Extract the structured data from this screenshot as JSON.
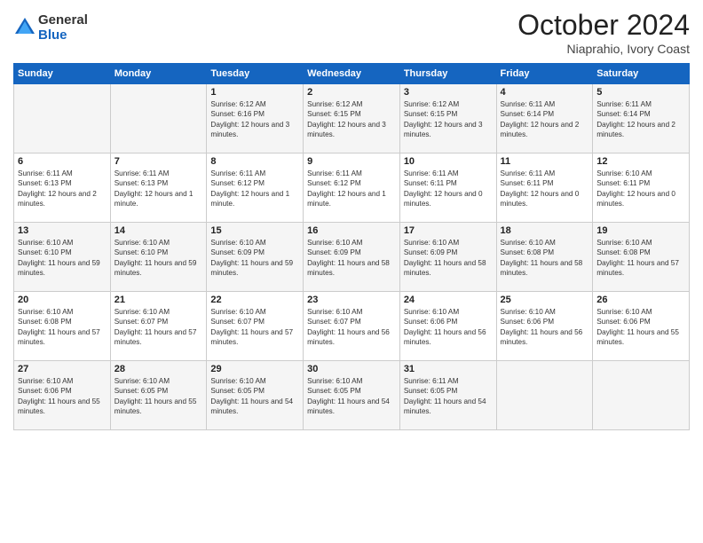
{
  "logo": {
    "line1": "General",
    "line2": "Blue"
  },
  "title": "October 2024",
  "subtitle": "Niaprahio, Ivory Coast",
  "days_of_week": [
    "Sunday",
    "Monday",
    "Tuesday",
    "Wednesday",
    "Thursday",
    "Friday",
    "Saturday"
  ],
  "weeks": [
    [
      {
        "day": "",
        "info": ""
      },
      {
        "day": "",
        "info": ""
      },
      {
        "day": "1",
        "info": "Sunrise: 6:12 AM\nSunset: 6:16 PM\nDaylight: 12 hours and 3 minutes."
      },
      {
        "day": "2",
        "info": "Sunrise: 6:12 AM\nSunset: 6:15 PM\nDaylight: 12 hours and 3 minutes."
      },
      {
        "day": "3",
        "info": "Sunrise: 6:12 AM\nSunset: 6:15 PM\nDaylight: 12 hours and 3 minutes."
      },
      {
        "day": "4",
        "info": "Sunrise: 6:11 AM\nSunset: 6:14 PM\nDaylight: 12 hours and 2 minutes."
      },
      {
        "day": "5",
        "info": "Sunrise: 6:11 AM\nSunset: 6:14 PM\nDaylight: 12 hours and 2 minutes."
      }
    ],
    [
      {
        "day": "6",
        "info": "Sunrise: 6:11 AM\nSunset: 6:13 PM\nDaylight: 12 hours and 2 minutes."
      },
      {
        "day": "7",
        "info": "Sunrise: 6:11 AM\nSunset: 6:13 PM\nDaylight: 12 hours and 1 minute."
      },
      {
        "day": "8",
        "info": "Sunrise: 6:11 AM\nSunset: 6:12 PM\nDaylight: 12 hours and 1 minute."
      },
      {
        "day": "9",
        "info": "Sunrise: 6:11 AM\nSunset: 6:12 PM\nDaylight: 12 hours and 1 minute."
      },
      {
        "day": "10",
        "info": "Sunrise: 6:11 AM\nSunset: 6:11 PM\nDaylight: 12 hours and 0 minutes."
      },
      {
        "day": "11",
        "info": "Sunrise: 6:11 AM\nSunset: 6:11 PM\nDaylight: 12 hours and 0 minutes."
      },
      {
        "day": "12",
        "info": "Sunrise: 6:10 AM\nSunset: 6:11 PM\nDaylight: 12 hours and 0 minutes."
      }
    ],
    [
      {
        "day": "13",
        "info": "Sunrise: 6:10 AM\nSunset: 6:10 PM\nDaylight: 11 hours and 59 minutes."
      },
      {
        "day": "14",
        "info": "Sunrise: 6:10 AM\nSunset: 6:10 PM\nDaylight: 11 hours and 59 minutes."
      },
      {
        "day": "15",
        "info": "Sunrise: 6:10 AM\nSunset: 6:09 PM\nDaylight: 11 hours and 59 minutes."
      },
      {
        "day": "16",
        "info": "Sunrise: 6:10 AM\nSunset: 6:09 PM\nDaylight: 11 hours and 58 minutes."
      },
      {
        "day": "17",
        "info": "Sunrise: 6:10 AM\nSunset: 6:09 PM\nDaylight: 11 hours and 58 minutes."
      },
      {
        "day": "18",
        "info": "Sunrise: 6:10 AM\nSunset: 6:08 PM\nDaylight: 11 hours and 58 minutes."
      },
      {
        "day": "19",
        "info": "Sunrise: 6:10 AM\nSunset: 6:08 PM\nDaylight: 11 hours and 57 minutes."
      }
    ],
    [
      {
        "day": "20",
        "info": "Sunrise: 6:10 AM\nSunset: 6:08 PM\nDaylight: 11 hours and 57 minutes."
      },
      {
        "day": "21",
        "info": "Sunrise: 6:10 AM\nSunset: 6:07 PM\nDaylight: 11 hours and 57 minutes."
      },
      {
        "day": "22",
        "info": "Sunrise: 6:10 AM\nSunset: 6:07 PM\nDaylight: 11 hours and 57 minutes."
      },
      {
        "day": "23",
        "info": "Sunrise: 6:10 AM\nSunset: 6:07 PM\nDaylight: 11 hours and 56 minutes."
      },
      {
        "day": "24",
        "info": "Sunrise: 6:10 AM\nSunset: 6:06 PM\nDaylight: 11 hours and 56 minutes."
      },
      {
        "day": "25",
        "info": "Sunrise: 6:10 AM\nSunset: 6:06 PM\nDaylight: 11 hours and 56 minutes."
      },
      {
        "day": "26",
        "info": "Sunrise: 6:10 AM\nSunset: 6:06 PM\nDaylight: 11 hours and 55 minutes."
      }
    ],
    [
      {
        "day": "27",
        "info": "Sunrise: 6:10 AM\nSunset: 6:06 PM\nDaylight: 11 hours and 55 minutes."
      },
      {
        "day": "28",
        "info": "Sunrise: 6:10 AM\nSunset: 6:05 PM\nDaylight: 11 hours and 55 minutes."
      },
      {
        "day": "29",
        "info": "Sunrise: 6:10 AM\nSunset: 6:05 PM\nDaylight: 11 hours and 54 minutes."
      },
      {
        "day": "30",
        "info": "Sunrise: 6:10 AM\nSunset: 6:05 PM\nDaylight: 11 hours and 54 minutes."
      },
      {
        "day": "31",
        "info": "Sunrise: 6:11 AM\nSunset: 6:05 PM\nDaylight: 11 hours and 54 minutes."
      },
      {
        "day": "",
        "info": ""
      },
      {
        "day": "",
        "info": ""
      }
    ]
  ]
}
